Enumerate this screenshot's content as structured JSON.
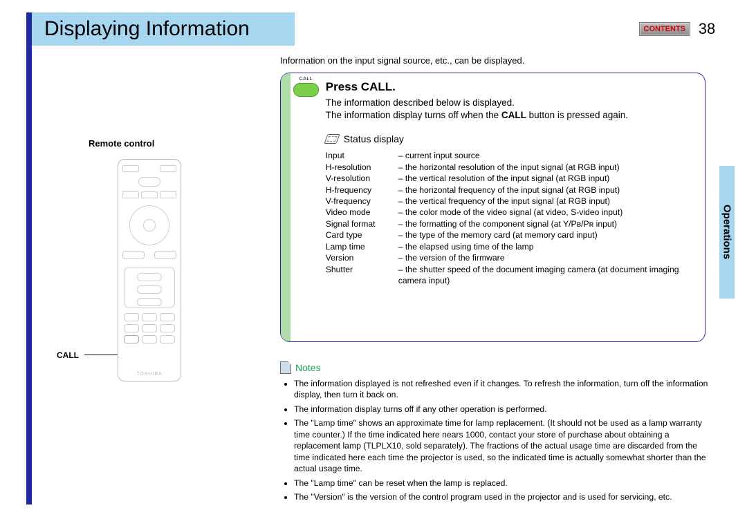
{
  "header": {
    "title": "Displaying Information",
    "contents_label": "CONTENTS",
    "page_number": "38"
  },
  "section_tab": "Operations",
  "intro": "Information on the input signal source, etc., can be displayed.",
  "left": {
    "remote_label": "Remote control",
    "call_label": "CALL",
    "remote_brand": "TOSHIBA"
  },
  "panel": {
    "call_button_caption": "CALL",
    "press_heading": "Press CALL.",
    "press_body_1": "The information described below is displayed.",
    "press_body_2a": "The information display turns off when the ",
    "press_body_2b": "CALL",
    "press_body_2c": " button is pressed again.",
    "status_heading": "Status display",
    "items": [
      {
        "k": "Input",
        "v": "– current input source"
      },
      {
        "k": "H-resolution",
        "v": "– the horizontal resolution of the input signal (at RGB input)"
      },
      {
        "k": "V-resolution",
        "v": "– the vertical resolution of the input signal (at RGB input)"
      },
      {
        "k": "H-frequency",
        "v": "– the horizontal frequency of the input signal (at RGB input)"
      },
      {
        "k": "V-frequency",
        "v": "– the vertical frequency of the input signal (at RGB input)"
      },
      {
        "k": "Video mode",
        "v": "– the color mode of the video signal (at video, S-video input)"
      },
      {
        "k": "Signal format",
        "v": "– the formatting of the component signal (at Y/Pʙ/Pʀ input)"
      },
      {
        "k": "Card type",
        "v": "– the type of the memory card (at memory card input)"
      },
      {
        "k": "Lamp time",
        "v": "– the elapsed using time of the lamp"
      },
      {
        "k": "Version",
        "v": "– the version of the firmware"
      },
      {
        "k": "Shutter",
        "v": "– the shutter speed of the document imaging camera (at document imaging camera input)"
      }
    ]
  },
  "notes": {
    "heading": "Notes",
    "items": [
      "The information displayed is not refreshed even if it changes. To refresh the information, turn off the information display, then turn it back on.",
      "The information display turns off if any other operation is performed.",
      "The \"Lamp time\" shows an approximate time for lamp replacement. (It should not be used as a lamp warranty time counter.) If the time indicated here nears 1000, contact your store of purchase about obtaining a replacement lamp (TLPLX10, sold separately). The fractions of the actual usage time are discarded from the time indicated here each time the projector is used, so the indicated time is actually somewhat shorter than the actual usage time.",
      "The \"Lamp time\" can be reset when the lamp is replaced.",
      "The \"Version\" is the version of the control program used in the projector and is used for servicing, etc."
    ]
  }
}
